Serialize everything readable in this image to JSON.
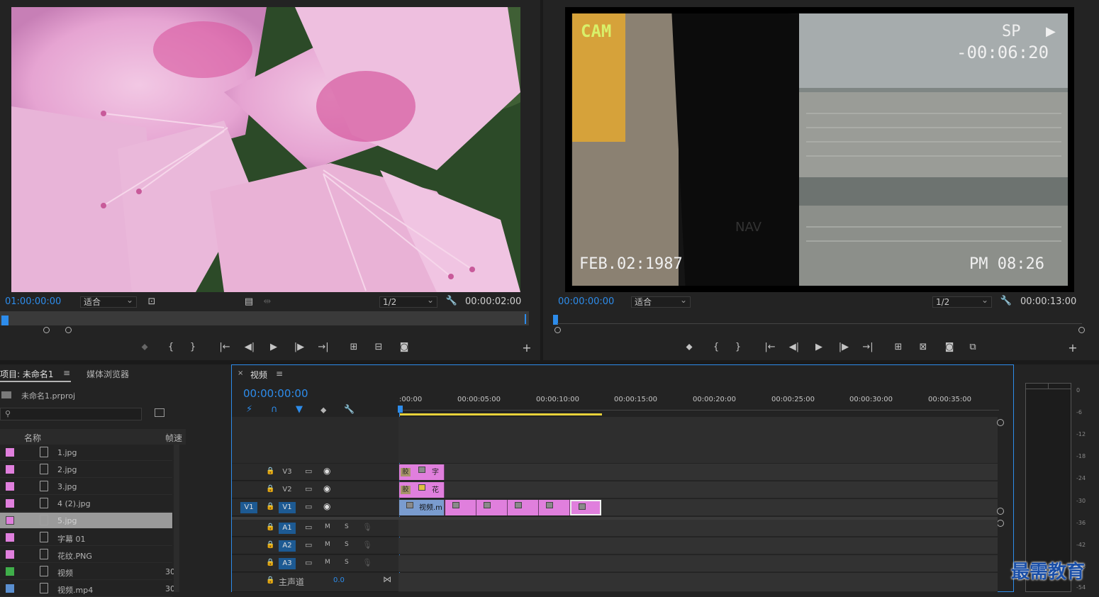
{
  "source_monitor": {
    "timecode_left": "01:00:00:00",
    "fit_label": "适合",
    "resolution": "1/2",
    "duration": "00:00:02:00"
  },
  "program_monitor": {
    "timecode_left": "00:00:00:00",
    "fit_label": "适合",
    "resolution": "1/2",
    "duration": "00:00:13:00",
    "vhs": {
      "cam": "CAM",
      "sp": "SP",
      "counter": "-00:06:20",
      "date": "FEB.02:1987",
      "time": "PM 08:26",
      "logo": "NAV"
    }
  },
  "project": {
    "tab_title": "项目: 未命名1",
    "tab_media": "媒体浏览器",
    "project_file": "未命名1.prproj",
    "col_name": "名称",
    "col_rate": "帧速",
    "items": [
      {
        "name": "1.jpg",
        "color": "#e07fdd",
        "rate": ""
      },
      {
        "name": "2.jpg",
        "color": "#e07fdd",
        "rate": ""
      },
      {
        "name": "3.jpg",
        "color": "#e07fdd",
        "rate": ""
      },
      {
        "name": "4 (2).jpg",
        "color": "#e07fdd",
        "rate": ""
      },
      {
        "name": "5.jpg",
        "color": "#e07fdd",
        "rate": ""
      },
      {
        "name": "字幕 01",
        "color": "#e07fdd",
        "rate": ""
      },
      {
        "name": "花纹.PNG",
        "color": "#e07fdd",
        "rate": ""
      },
      {
        "name": "视频",
        "color": "#3fae4a",
        "rate": "30"
      },
      {
        "name": "视频.mp4",
        "color": "#5a8fd0",
        "rate": "30"
      }
    ]
  },
  "timeline": {
    "tab_title": "视频",
    "timecode": "00:00:00:00",
    "ruler": [
      ":00:00",
      "00:00:05:00",
      "00:00:10:00",
      "00:00:15:00",
      "00:00:20:00",
      "00:00:25:00",
      "00:00:30:00",
      "00:00:35:00"
    ],
    "tracks_video": [
      "V3",
      "V2",
      "V1"
    ],
    "tracks_audio": [
      "A1",
      "A2",
      "A3"
    ],
    "source_patch": "V1",
    "mute": "M",
    "solo": "S",
    "master_label": "主声道",
    "master_value": "0.0",
    "clip_v3": "字",
    "clip_v2": "花",
    "clip_v1": "视频.m",
    "clip_badge": "胶"
  },
  "meter": {
    "labels": [
      "0",
      "-6",
      "-12",
      "-18",
      "-24",
      "-30",
      "-36",
      "-42",
      "-48",
      "-54"
    ]
  },
  "watermark": "最需教育"
}
